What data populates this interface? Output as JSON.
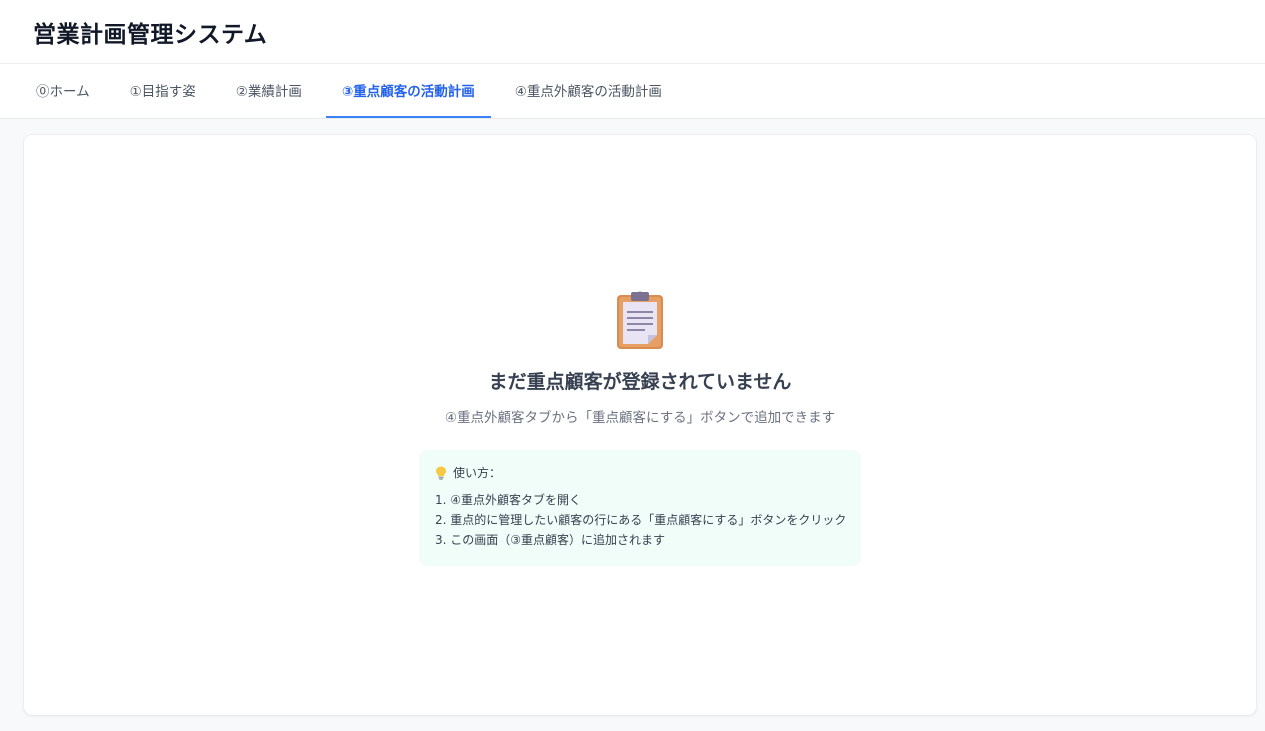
{
  "app": {
    "title": "営業計画管理システム"
  },
  "tabs": [
    {
      "label": "⓪ホーム",
      "active": false
    },
    {
      "label": "①目指す姿",
      "active": false
    },
    {
      "label": "②業績計画",
      "active": false
    },
    {
      "label": "③重点顧客の活動計画",
      "active": true
    },
    {
      "label": "④重点外顧客の活動計画",
      "active": false
    }
  ],
  "empty_state": {
    "icon": "clipboard-icon",
    "title": "まだ重点顧客が登録されていません",
    "subtitle": "④重点外顧客タブから「重点顧客にする」ボタンで追加できます"
  },
  "howto": {
    "icon": "lightbulb-icon",
    "heading": "使い方：",
    "steps": [
      "1. ④重点外顧客タブを開く",
      "2. 重点的に管理したい顧客の行にある「重点顧客にする」ボタンをクリック",
      "3. この画面（③重点顧客）に追加されます"
    ]
  },
  "colors": {
    "accent": "#2563eb",
    "tab_underline": "#3b82f6",
    "howto_background": "#f0fdf9",
    "page_background": "#f8f9fb"
  }
}
